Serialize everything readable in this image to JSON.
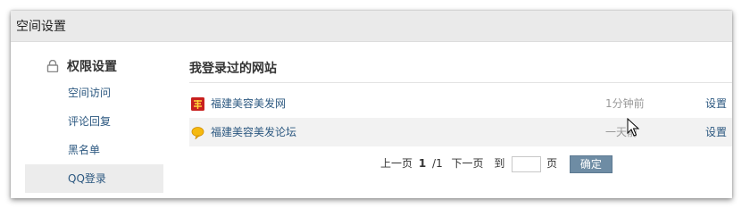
{
  "window": {
    "title": "空间设置"
  },
  "sidebar": {
    "heading": "权限设置",
    "items": [
      {
        "label": "空间访问",
        "active": false
      },
      {
        "label": "评论回复",
        "active": false
      },
      {
        "label": "黑名单",
        "active": false
      },
      {
        "label": "QQ登录",
        "active": true
      }
    ]
  },
  "main": {
    "title": "我登录过的网站",
    "rows": [
      {
        "site": "福建美容美发网",
        "time": "1分钟前",
        "action": "设置",
        "icon": "red-logo-icon"
      },
      {
        "site": "福建美容美发论坛",
        "time": "一天前",
        "action": "设置",
        "icon": "yellow-bubble-icon"
      }
    ]
  },
  "pager": {
    "prev": "上一页",
    "current": "1",
    "total": "/1",
    "next": "下一页",
    "goto": "到",
    "unit": "页",
    "input_value": "",
    "confirm": "确定"
  },
  "colors": {
    "link": "#2c5880",
    "button": "#6e8ca4",
    "titlebar": "#eaeaea",
    "active_item": "#ececec"
  }
}
